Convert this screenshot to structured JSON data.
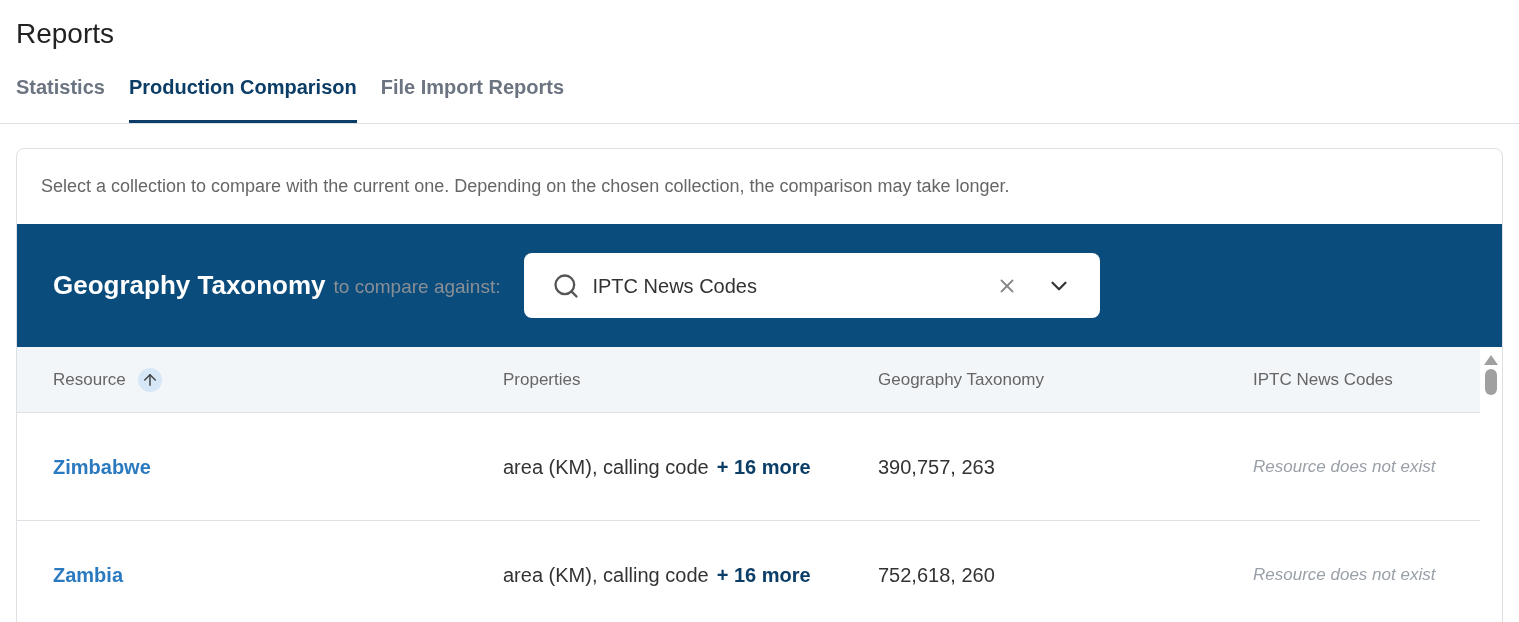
{
  "page_title": "Reports",
  "tabs": [
    {
      "label": "Statistics",
      "selected": false
    },
    {
      "label": "Production Comparison",
      "selected": true
    },
    {
      "label": "File Import Reports",
      "selected": false
    }
  ],
  "intro": "Select a collection to compare with the current one. Depending on the chosen collection, the comparison may take longer.",
  "banner": {
    "collection": "Geography Taxonomy",
    "connector": "to compare against:",
    "select": {
      "value": "IPTC News Codes"
    }
  },
  "table": {
    "columns": [
      {
        "label": "Resource",
        "sorted": true
      },
      {
        "label": "Properties",
        "sorted": false
      },
      {
        "label": "Geography Taxonomy",
        "sorted": false
      },
      {
        "label": "IPTC News Codes",
        "sorted": false
      }
    ],
    "rows": [
      {
        "resource": "Zimbabwe",
        "properties": "area (KM), calling code",
        "more": "+ 16 more",
        "current": "390,757, 263",
        "compared": "Resource does not exist"
      },
      {
        "resource": "Zambia",
        "properties": "area (KM), calling code",
        "more": "+ 16 more",
        "current": "752,618, 260",
        "compared": "Resource does not exist"
      }
    ]
  }
}
